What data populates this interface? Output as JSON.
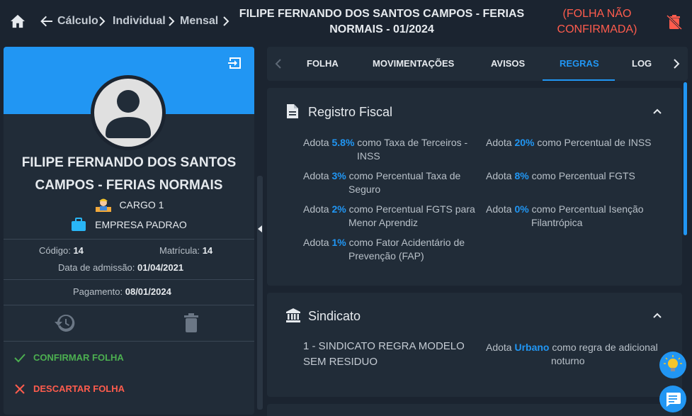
{
  "breadcrumb": [
    "Cálculo",
    "Individual",
    "Mensal"
  ],
  "header": {
    "title_line1": "FILIPE FERNANDO DOS SANTOS CAMPOS - FERIAS",
    "title_line2": "NORMAIS - 01/2024",
    "status_line1": "(FOLHA NÃO",
    "status_line2": "CONFIRMADA)"
  },
  "employee": {
    "name_line1": "FILIPE FERNANDO DOS SANTOS",
    "name_line2": "CAMPOS - FERIAS NORMAIS",
    "cargo": "CARGO 1",
    "empresa": "EMPRESA PADRAO",
    "codigo_label": "Código:",
    "codigo": "14",
    "matricula_label": "Matrícula:",
    "matricula": "14",
    "admissao_label": "Data de admissão:",
    "admissao": "01/04/2021",
    "pagamento_label": "Pagamento:",
    "pagamento": "08/01/2024"
  },
  "actions": {
    "confirm": "CONFIRMAR FOLHA",
    "discard": "DESCARTAR FOLHA"
  },
  "tabs": [
    "FOLHA",
    "MOVIMENTAÇÕES",
    "AVISOS",
    "REGRAS",
    "LOG"
  ],
  "active_tab": "REGRAS",
  "registro_fiscal": {
    "title": "Registro Fiscal",
    "rules": [
      {
        "pre": "Adota",
        "value": "5.8%",
        "post": "como Taxa de Terceiros -",
        "cont": "INSS"
      },
      {
        "pre": "Adota",
        "value": "20%",
        "post": "como Percentual de INSS",
        "cont": ""
      },
      {
        "pre": "Adota",
        "value": "3%",
        "post": "como Percentual Taxa de",
        "cont": "Seguro"
      },
      {
        "pre": "Adota",
        "value": "8%",
        "post": "como Percentual FGTS",
        "cont": ""
      },
      {
        "pre": "Adota",
        "value": "2%",
        "post": "como Percentual FGTS para",
        "cont": "Menor Aprendiz"
      },
      {
        "pre": "Adota",
        "value": "0%",
        "post": "como Percentual Isenção",
        "cont": "Filantrópica"
      },
      {
        "pre": "Adota",
        "value": "1%",
        "post": "como Fator Acidentário de",
        "cont": "Prevenção (FAP)"
      }
    ]
  },
  "sindicato": {
    "title": "Sindicato",
    "name_line1": "1 - SINDICATO REGRA MODELO",
    "name_line2": "SEM RESIDUO",
    "rule": {
      "pre": "Adota",
      "value": "Urbano",
      "post": "como regra de adicional",
      "cont": "noturno"
    }
  },
  "colors": {
    "accent": "#2196f3",
    "danger": "#ff5c4d",
    "success": "#4caf50"
  }
}
